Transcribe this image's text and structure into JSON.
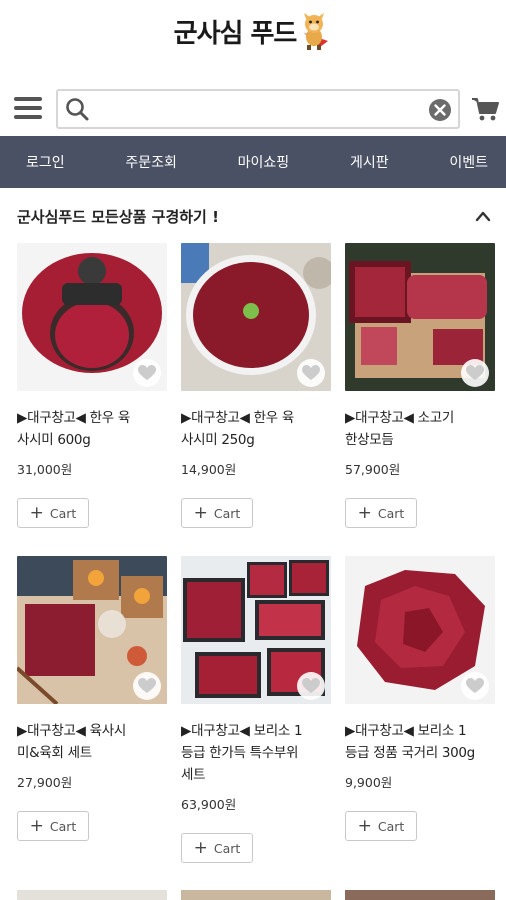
{
  "brand": {
    "logo_text": "군사심 푸드"
  },
  "search": {
    "placeholder": "",
    "value": ""
  },
  "nav": {
    "items": [
      "로그인",
      "주문조회",
      "마이쇼핑",
      "게시판",
      "이벤트"
    ]
  },
  "section": {
    "title": "군사심푸드 모든상품 구경하기 !"
  },
  "cart_label": "Cart",
  "products": [
    {
      "name_line1": "▶대구창고◀ 한우 육",
      "name_line2": "사시미 600g",
      "name_line3": "",
      "price": "31,000원"
    },
    {
      "name_line1": "▶대구창고◀ 한우 육",
      "name_line2": "사시미 250g",
      "name_line3": "",
      "price": "14,900원"
    },
    {
      "name_line1": "▶대구창고◀ 소고기",
      "name_line2": "한상모듬",
      "name_line3": "",
      "price": "57,900원"
    },
    {
      "name_line1": "▶대구창고◀ 육사시",
      "name_line2": "미&육회 세트",
      "name_line3": "",
      "price": "27,900원"
    },
    {
      "name_line1": "▶대구창고◀ 보리소 1",
      "name_line2": "등급 한가득 특수부위",
      "name_line3": "세트",
      "price": "63,900원"
    },
    {
      "name_line1": "▶대구창고◀ 보리소 1",
      "name_line2": "등급 정품 국거리 300g",
      "name_line3": "",
      "price": "9,900원"
    }
  ],
  "colors": {
    "nav_bg": "#4a5164",
    "meat": "#8b1d2c",
    "text": "#222222"
  }
}
